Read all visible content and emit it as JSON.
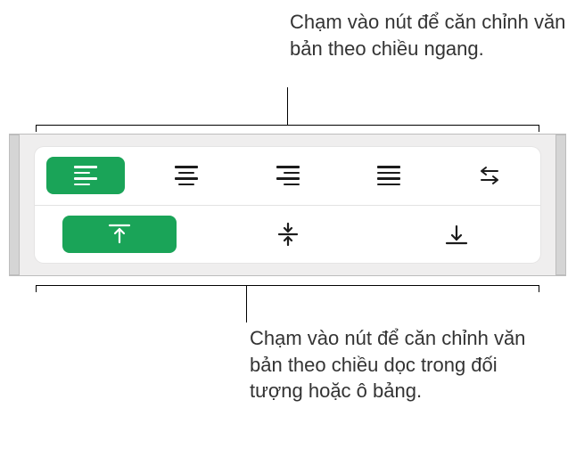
{
  "callouts": {
    "top": "Chạm vào nút để căn chỉnh văn bản theo chiều ngang.",
    "bottom": "Chạm vào nút để căn chỉnh văn bản theo chiều dọc trong đối tượng hoặc ô bảng."
  },
  "alignment": {
    "horizontal": {
      "selected": "left",
      "options": [
        "left",
        "center",
        "right",
        "justify",
        "direction"
      ]
    },
    "vertical": {
      "selected": "top",
      "options": [
        "top",
        "middle",
        "bottom"
      ]
    }
  },
  "colors": {
    "accent": "#1aa458"
  }
}
